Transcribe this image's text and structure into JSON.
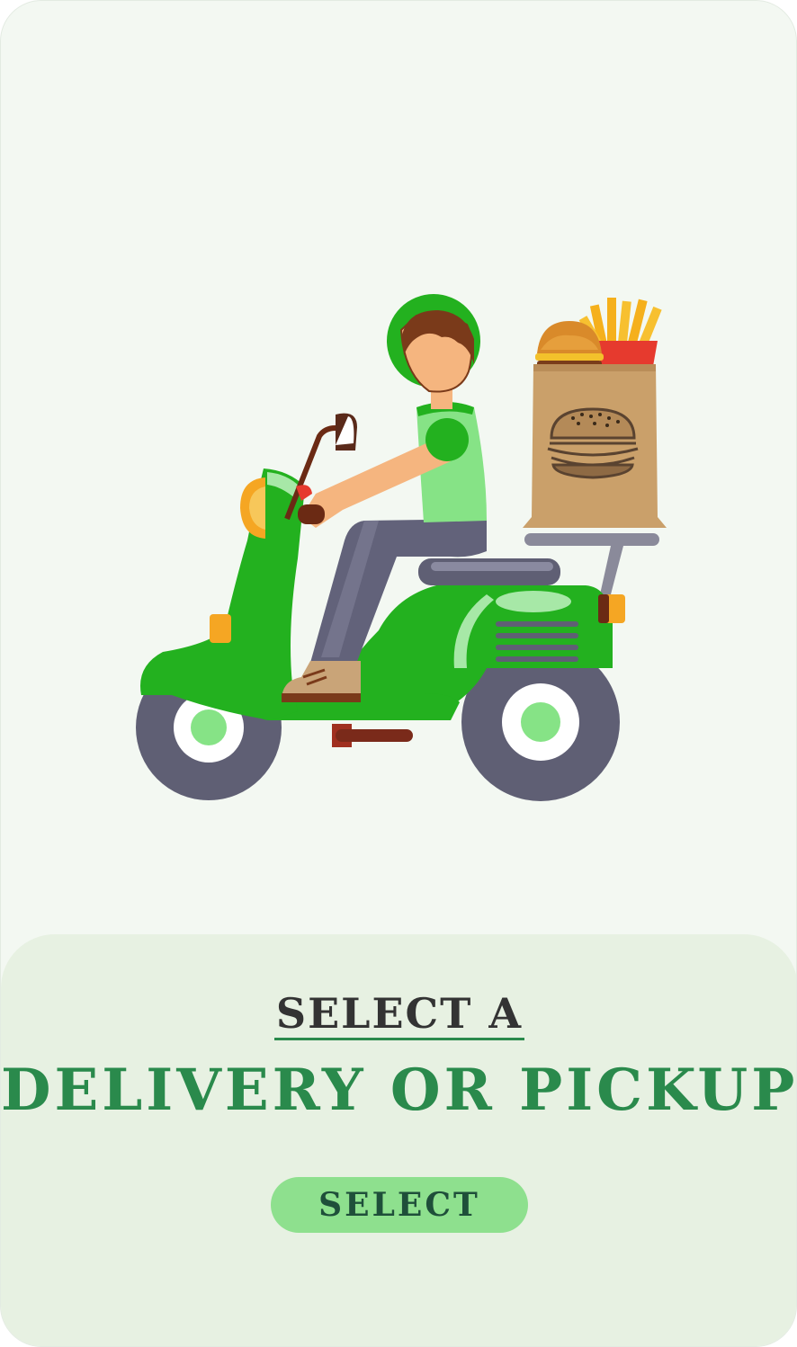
{
  "subtitle": "SELECT A",
  "headline": "DELIVERY OR PICKUP",
  "button_label": "SELECT",
  "colors": {
    "card_background": "#f3f8f2",
    "panel_background": "#e7f1e2",
    "headline": "#2a8a4c",
    "subtitle": "#333333",
    "button_background": "#8ee08e",
    "button_text": "#1f4f3a",
    "scooter_green": "#23b11f"
  },
  "illustration": {
    "subject": "delivery-rider-on-scooter",
    "icons": [
      "helmet-icon",
      "burger-icon",
      "fries-icon",
      "paper-bag-icon",
      "scooter-icon"
    ]
  }
}
